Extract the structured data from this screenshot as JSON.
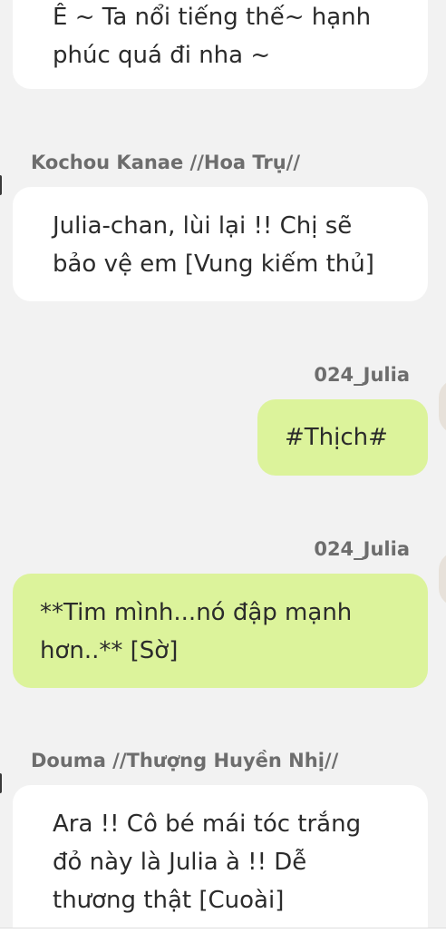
{
  "colors": {
    "background": "#f2f2f2",
    "incoming_bubble": "#ffffff",
    "outgoing_bubble": "#dcf39b",
    "sender_name": "#6d6d6d",
    "text": "#2b2b2b"
  },
  "messages": [
    {
      "direction": "incoming",
      "sender": "",
      "text": "Ê ~ Ta nổi tiếng thế~ hạnh\nphúc quá đi nha ~"
    },
    {
      "direction": "incoming",
      "sender": "Kochou Kanae //Hoa Trụ//",
      "text": "Julia-chan, lùi lại !! Chị sẽ\nbảo vệ em [Vung kiếm thủ]"
    },
    {
      "direction": "outgoing",
      "sender": "024_Julia",
      "text": "#Thịch#"
    },
    {
      "direction": "outgoing",
      "sender": "024_Julia",
      "text": "**Tim mình...nó đập mạnh\nhơn..** [Sờ]"
    },
    {
      "direction": "incoming",
      "sender": "Douma //Thượng Huyền Nhị//",
      "text": "Ara !! Cô bé mái tóc trắng\nđỏ này là Julia à !! Dễ\nthương thật [Cuoài]"
    }
  ]
}
